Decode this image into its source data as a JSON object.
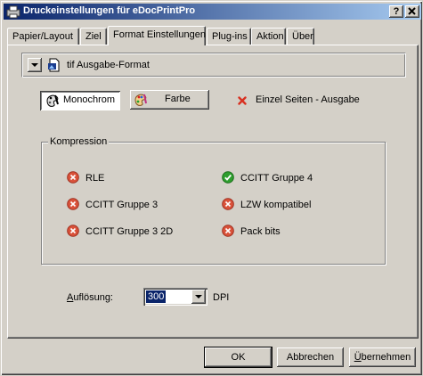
{
  "window": {
    "title": "Druckeinstellungen für eDocPrintPro",
    "help_button": "?",
    "close_button": "X"
  },
  "tabs": [
    {
      "label": "Papier/Layout",
      "active": false
    },
    {
      "label": "Ziel",
      "active": false
    },
    {
      "label": "Format Einstellungen",
      "active": true
    },
    {
      "label": "Plug-ins",
      "active": false
    },
    {
      "label": "Aktion",
      "active": false
    },
    {
      "label": "Über",
      "active": false
    }
  ],
  "format_selector": {
    "value": "tif Ausgabe-Format",
    "icon": "tif-file-icon"
  },
  "color_mode": {
    "monochrom_label": "Monochrom",
    "farbe_label": "Farbe",
    "selected": "Monochrom"
  },
  "single_pages": {
    "label": "Einzel Seiten - Ausgabe",
    "checked": false
  },
  "compression": {
    "legend": "Kompression",
    "selected": "CCITT Gruppe 4",
    "options": [
      {
        "label": "RLE",
        "selected": false
      },
      {
        "label": "CCITT Gruppe 4",
        "selected": true
      },
      {
        "label": "CCITT Gruppe 3",
        "selected": false
      },
      {
        "label": "LZW kompatibel",
        "selected": false
      },
      {
        "label": "CCITT Gruppe 3 2D",
        "selected": false
      },
      {
        "label": "Pack bits",
        "selected": false
      }
    ]
  },
  "resolution": {
    "label_underlined": "A",
    "label_rest": "uflösung:",
    "value": "300",
    "unit": "DPI"
  },
  "buttons": {
    "ok": "OK",
    "cancel": "Abbrechen",
    "apply_underlined": "Ü",
    "apply_rest": "bernehmen"
  },
  "colors": {
    "title_start": "#0a246a",
    "title_end": "#a6caf0",
    "face": "#d4d0c8",
    "selected_ok": "#2e9e2e",
    "not_selected": "#d9523a"
  }
}
